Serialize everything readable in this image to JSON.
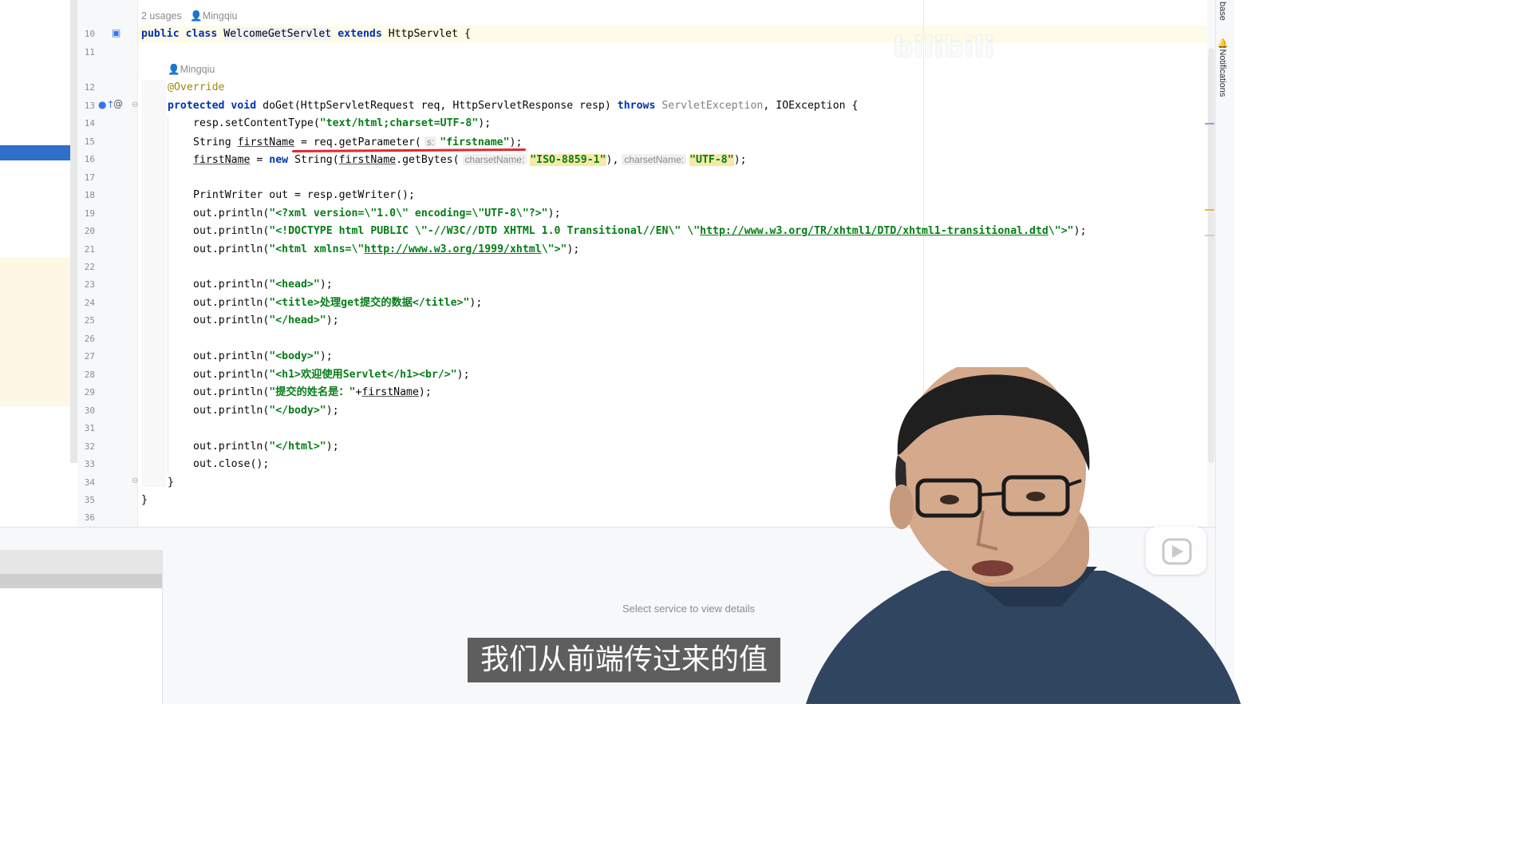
{
  "editor": {
    "class_meta": {
      "usages": "2 usages",
      "author": "Mingqiu"
    },
    "method_meta": {
      "author": "Mingqiu"
    },
    "line_numbers": [
      "10",
      "11",
      "12",
      "13",
      "14",
      "15",
      "16",
      "17",
      "18",
      "19",
      "20",
      "21",
      "22",
      "23",
      "24",
      "25",
      "26",
      "27",
      "28",
      "29",
      "30",
      "31",
      "32",
      "33",
      "34",
      "35",
      "36"
    ],
    "tokens": {
      "public": "public",
      "class": "class",
      "class_name": "WelcomeGetServlet",
      "extends": "extends",
      "super_class": "HttpServlet",
      "lbrace": " {",
      "override": "@Override",
      "protected": "protected",
      "void": "void",
      "method_sig": " doGet(HttpServletRequest req, HttpServletResponse resp) ",
      "throws": "throws",
      "servlet_exception": "ServletException",
      "io_exception": ", IOException {",
      "l14_a": "resp.setContentType(",
      "l14_s": "\"text/html;charset=UTF-8\"",
      "l14_b": ");",
      "l15_a": "String ",
      "l15_var": "firstName",
      "l15_b": " = req.getParameter(",
      "l15_hint": "s:",
      "l15_s": "\"firstname\"",
      "l15_c": ");",
      "l16_var": "firstName",
      "l16_eq": " = ",
      "l16_new": "new",
      "l16_a": " String(",
      "l16_var2": "firstName",
      "l16_b": ".getBytes(",
      "l16_hint1": "charsetName:",
      "l16_s1": "\"ISO-8859-1\"",
      "l16_c": "),",
      "l16_hint2": "charsetName:",
      "l16_s2": "\"UTF-8\"",
      "l16_d": ");",
      "l18": "PrintWriter out = resp.getWriter();",
      "l19_a": "out.println(",
      "l19_s": "\"<?xml version=\\\"1.0\\\" encoding=\\\"UTF-8\\\"?>\"",
      "l19_b": ");",
      "l20_a": "out.println(",
      "l20_s1": "\"<!DOCTYPE html PUBLIC \\\"-//W3C//DTD XHTML 1.0 Transitional//EN\\\" \\\"",
      "l20_link": "http://www.w3.org/TR/xhtml1/DTD/xhtml1-transitional.dtd",
      "l20_s2": "\\\">\"",
      "l20_b": ");",
      "l21_a": "out.println(",
      "l21_s1": "\"<html xmlns=\\\"",
      "l21_link": "http://www.w3.org/1999/xhtml",
      "l21_s2": "\\\">\"",
      "l21_b": ");",
      "l23_a": "out.println(",
      "l23_s": "\"<head>\"",
      "l23_b": ");",
      "l24_a": "out.println(",
      "l24_s": "\"<title>处理get提交的数据</title>\"",
      "l24_b": ");",
      "l25_a": "out.println(",
      "l25_s": "\"</head>\"",
      "l25_b": ");",
      "l27_a": "out.println(",
      "l27_s": "\"<body>\"",
      "l27_b": ");",
      "l28_a": "out.println(",
      "l28_s": "\"<h1>欢迎使用Servlet</h1><br/>\"",
      "l28_b": ");",
      "l29_a": "out.println(",
      "l29_s": "\"提交的姓名是：\"",
      "l29_plus": "+",
      "l29_var": "firstName",
      "l29_b": ");",
      "l30_a": "out.println(",
      "l30_s": "\"</body>\"",
      "l30_b": ");",
      "l32_a": "out.println(",
      "l32_s": "\"</html>\"",
      "l32_b": ");",
      "l33": "out.close();",
      "l34": "}",
      "l35": "}"
    }
  },
  "right_toolwindows": {
    "database": "base",
    "notifications": "Notifications"
  },
  "services": {
    "empty_text": "Select service to view details"
  },
  "overlay": {
    "subtitle": "我们从前端传过来的值",
    "watermark": "bilibili"
  },
  "colors": {
    "keyword": "#0033b3",
    "string": "#067d17",
    "annotation": "#9e880d",
    "selection": "#2f6fc9",
    "underline_mark": "#e3262d"
  }
}
